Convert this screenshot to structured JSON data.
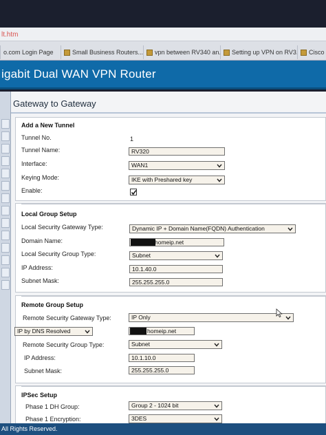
{
  "browser": {
    "url_fragment": "lt.htm",
    "tabs": [
      {
        "label": "o.com Login Page"
      },
      {
        "label": "Small Business Routers..."
      },
      {
        "label": "vpn between RV340 an..."
      },
      {
        "label": "Setting up VPN on RV3..."
      },
      {
        "label": "Cisco RV"
      }
    ]
  },
  "header": {
    "title": "igabit Dual WAN VPN Router"
  },
  "page": {
    "title": "Gateway to Gateway"
  },
  "add_tunnel": {
    "heading": "Add a New Tunnel",
    "tunnel_no_label": "Tunnel No.",
    "tunnel_no_value": "1",
    "tunnel_name_label": "Tunnel Name:",
    "tunnel_name_value": "RV320",
    "interface_label": "Interface:",
    "interface_value": "WAN1",
    "keying_mode_label": "Keying Mode:",
    "keying_mode_value": "IKE with Preshared key",
    "enable_label": "Enable:",
    "enable_checked": true
  },
  "local_group": {
    "heading": "Local Group Setup",
    "gateway_type_label": "Local Security Gateway Type:",
    "gateway_type_value": "Dynamic IP + Domain Name(FQDN) Authentication",
    "domain_name_label": "Domain Name:",
    "domain_name_value": "homeip.net",
    "group_type_label": "Local Security Group Type:",
    "group_type_value": "Subnet",
    "ip_label": "IP Address:",
    "ip_value": "10.1.40.0",
    "mask_label": "Subnet Mask:",
    "mask_value": "255.255.255.0"
  },
  "remote_group": {
    "heading": "Remote Group Setup",
    "gateway_type_label": "Remote Security Gateway Type:",
    "gateway_type_value": "IP Only",
    "resolve_value": "IP by DNS Resolved",
    "resolve_host_value": "homeip.net",
    "group_type_label": "Remote Security Group Type:",
    "group_type_value": "Subnet",
    "ip_label": "IP Address:",
    "ip_value": "10.1.10.0",
    "mask_label": "Subnet Mask:",
    "mask_value": "255.255.255.0"
  },
  "ipsec": {
    "heading": "IPSec Setup",
    "dh_group_label": "Phase 1 DH Group:",
    "dh_group_value": "Group 2 - 1024 bit",
    "encryption_label": "Phase 1 Encryption:",
    "encryption_value": "3DES"
  },
  "footer": {
    "text": "All Rights Reserved."
  },
  "icons": [
    "chevron-down-icon",
    "checkmark-icon",
    "mouse-cursor-icon",
    "favicon-icon"
  ],
  "colors": {
    "header_blue": "#0f6aa8",
    "footer_blue": "#1d4f7f",
    "field_bg": "#f6f2ea"
  }
}
